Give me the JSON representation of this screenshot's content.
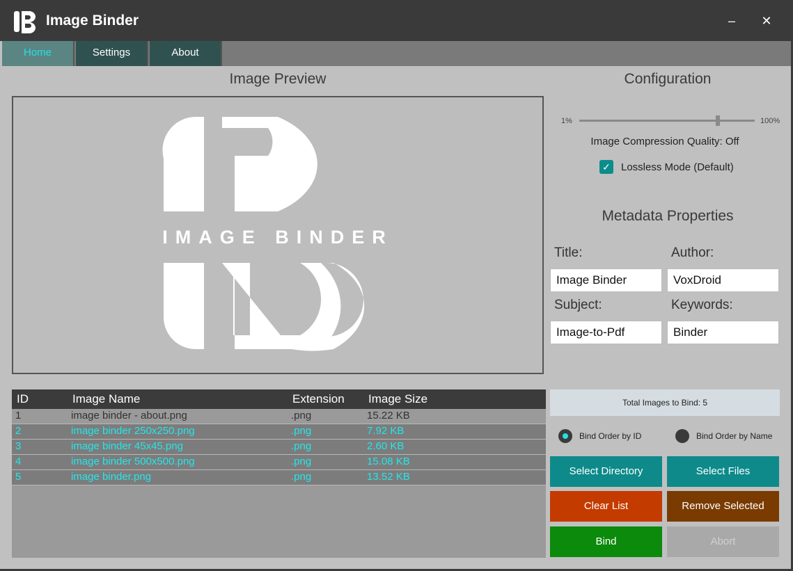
{
  "window": {
    "title": "Image Binder",
    "minimize_icon": "minimize-icon",
    "close_icon": "close-icon",
    "minimize_glyph": "–",
    "close_glyph": "✕"
  },
  "tabs": [
    {
      "label": "Home"
    },
    {
      "label": "Settings"
    },
    {
      "label": "About"
    }
  ],
  "preview": {
    "title": "Image Preview",
    "logo_text": "IMAGE BINDER"
  },
  "configuration": {
    "title": "Configuration",
    "slider": {
      "min_label": "1%",
      "max_label": "100%",
      "value_percent": 79
    },
    "quality_text": "Image Compression Quality: Off",
    "lossless_checked": true,
    "lossless_label": "Lossless Mode (Default)"
  },
  "metadata": {
    "title": "Metadata Properties",
    "fields": {
      "title": {
        "label": "Title:",
        "value": "Image Binder"
      },
      "author": {
        "label": "Author:",
        "value": "VoxDroid"
      },
      "subject": {
        "label": "Subject:",
        "value": "Image-to-Pdf"
      },
      "keywords": {
        "label": "Keywords:",
        "value": "Binder"
      }
    }
  },
  "table": {
    "headers": {
      "id": "ID",
      "name": "Image Name",
      "extension": "Extension",
      "size": "Image Size"
    },
    "rows": [
      {
        "id": "1",
        "name": "image binder - about.png",
        "extension": ".png",
        "size": "15.22 KB",
        "selected": false
      },
      {
        "id": "2",
        "name": "image binder 250x250.png",
        "extension": ".png",
        "size": "7.92 KB",
        "selected": true
      },
      {
        "id": "3",
        "name": "image binder 45x45.png",
        "extension": ".png",
        "size": "2.60 KB",
        "selected": true
      },
      {
        "id": "4",
        "name": "image binder 500x500.png",
        "extension": ".png",
        "size": "15.08 KB",
        "selected": true
      },
      {
        "id": "5",
        "name": "image binder.png",
        "extension": ".png",
        "size": "13.52 KB",
        "selected": true
      }
    ]
  },
  "summary": {
    "total_text": "Total Images to Bind: 5"
  },
  "bind_order": {
    "by_id": {
      "label": "Bind Order by ID",
      "selected": true
    },
    "by_name": {
      "label": "Bind Order by Name",
      "selected": false
    }
  },
  "buttons": {
    "select_directory": "Select Directory",
    "select_files": "Select Files",
    "clear_list": "Clear List",
    "remove_selected": "Remove Selected",
    "bind": "Bind",
    "abort": "Abort"
  },
  "colors": {
    "accent": "#25e0e6",
    "teal": "#0e8a8a",
    "orange": "#c43b00",
    "brown": "#7a3b00",
    "green": "#0b8a0b"
  }
}
